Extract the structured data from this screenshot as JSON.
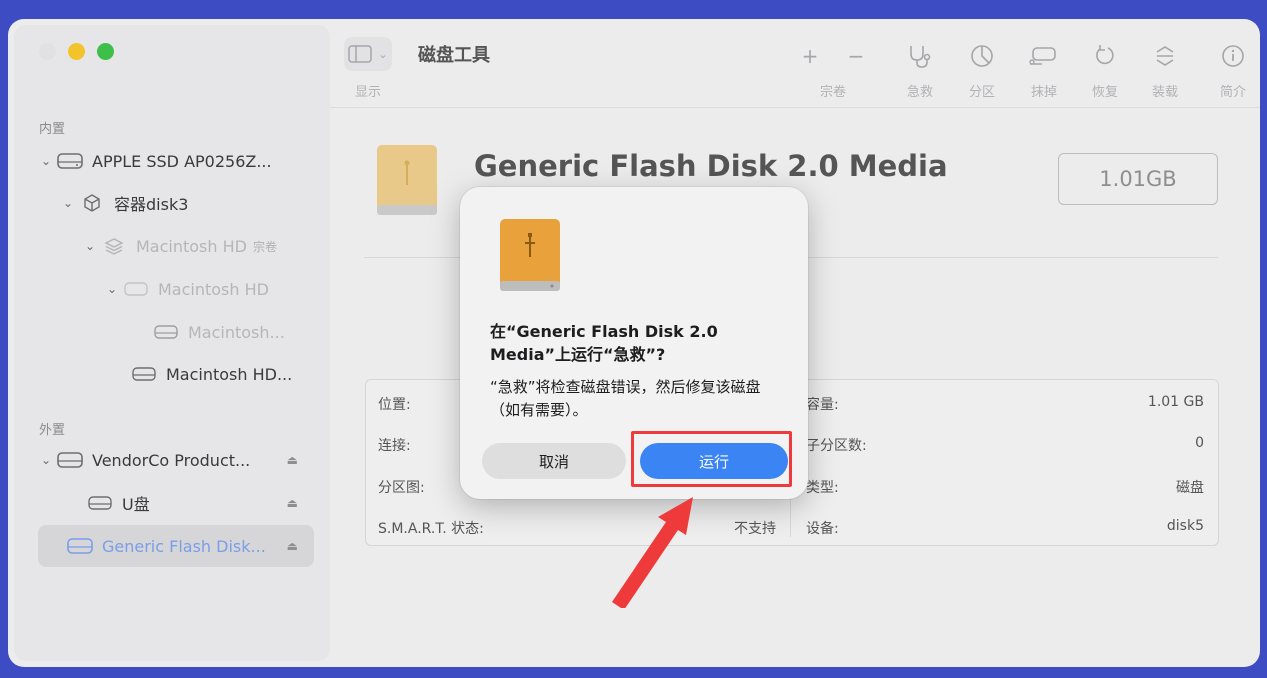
{
  "sidebar": {
    "internal_label": "内置",
    "external_label": "外置",
    "items": [
      {
        "label": "APPLE SSD AP0256Z..."
      },
      {
        "label": "容器disk3"
      },
      {
        "label": "Macintosh HD",
        "sub": "宗卷"
      },
      {
        "label": "Macintosh HD"
      },
      {
        "label": "Macintosh..."
      },
      {
        "label": "Macintosh HD..."
      },
      {
        "label": "VendorCo Product..."
      },
      {
        "label": "U盘"
      },
      {
        "label": "Generic Flash Disk..."
      }
    ]
  },
  "toolbar": {
    "title": "磁盘工具",
    "view_label": "显示",
    "volume_label": "宗卷",
    "firstaid_label": "急救",
    "partition_label": "分区",
    "erase_label": "抹掉",
    "restore_label": "恢复",
    "mount_label": "装载",
    "info_label": "简介",
    "add_glyph": "+",
    "remove_glyph": "−"
  },
  "disk": {
    "name": "Generic Flash Disk 2.0 Media",
    "capacity": "1.01GB"
  },
  "info": {
    "location_label": "位置:",
    "connection_label": "连接:",
    "partition_map_label": "分区图:",
    "smart_label": "S.M.A.R.T. 状态:",
    "smart_value": "不支持",
    "capacity_label": "容量:",
    "capacity_value": "1.01 GB",
    "child_count_label": "子分区数:",
    "child_count_value": "0",
    "type_label": "类型:",
    "type_value": "磁盘",
    "device_label": "设备:",
    "device_value": "disk5"
  },
  "dialog": {
    "title": "在“Generic Flash Disk 2.0 Media”上运行“急救”?",
    "body": "“急救”将检查磁盘错误，然后修复该磁盘（如有需要）。",
    "cancel_label": "取消",
    "run_label": "运行"
  },
  "colors": {
    "background": "#3e4cc4",
    "accent": "#3a84f4",
    "highlight": "#ee3a3a",
    "disk_orange": "#e9a23b"
  }
}
